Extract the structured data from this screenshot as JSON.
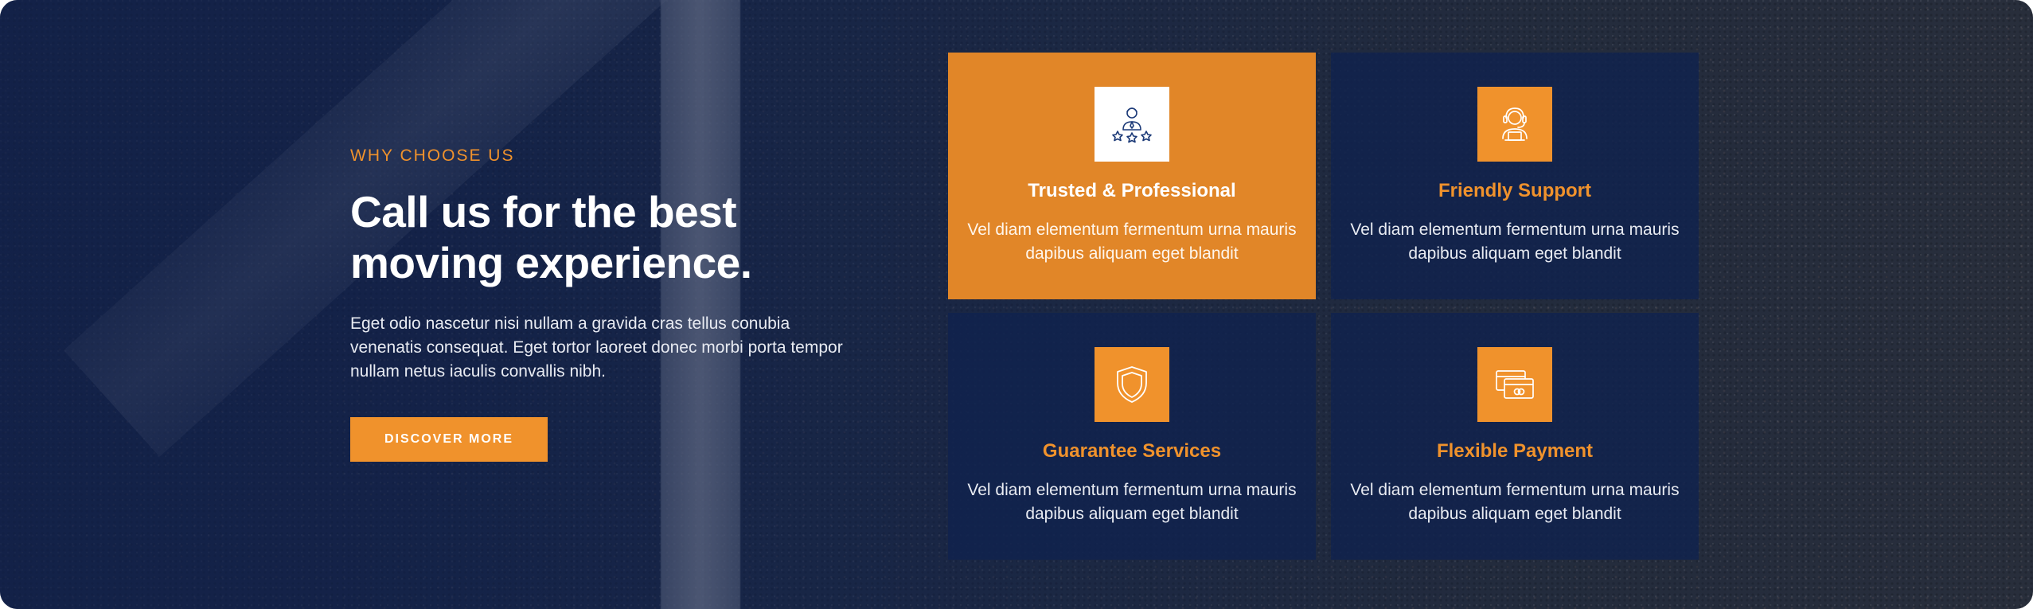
{
  "section": {
    "eyebrow": "WHY CHOOSE US",
    "headline_line1": "Call us for the best",
    "headline_line2": "moving experience.",
    "paragraph": "Eget odio nascetur nisi nullam a gravida cras tellus conubia venenatis consequat. Eget tortor laoreet donec morbi porta tempor nullam netus iaculis convallis nibh.",
    "cta_label": "DISCOVER MORE"
  },
  "features": [
    {
      "title": "Trusted & Professional",
      "text": "Vel diam elementum fermentum urna mauris dapibus aliquam eget blandit",
      "icon": "trusted-team-icon",
      "highlighted": true
    },
    {
      "title": "Friendly Support",
      "text": "Vel diam elementum fermentum urna mauris dapibus aliquam eget blandit",
      "icon": "support-agent-icon",
      "highlighted": false
    },
    {
      "title": "Guarantee Services",
      "text": "Vel diam elementum fermentum urna mauris dapibus aliquam eget blandit",
      "icon": "shield-icon",
      "highlighted": false
    },
    {
      "title": "Flexible Payment",
      "text": "Vel diam elementum fermentum urna mauris dapibus aliquam eget blandit",
      "icon": "credit-card-icon",
      "highlighted": false
    }
  ],
  "colors": {
    "accent": "#f0922c",
    "card_background": "#10224e",
    "highlight_card": "#e18628",
    "text_light": "#e8ebf2"
  }
}
